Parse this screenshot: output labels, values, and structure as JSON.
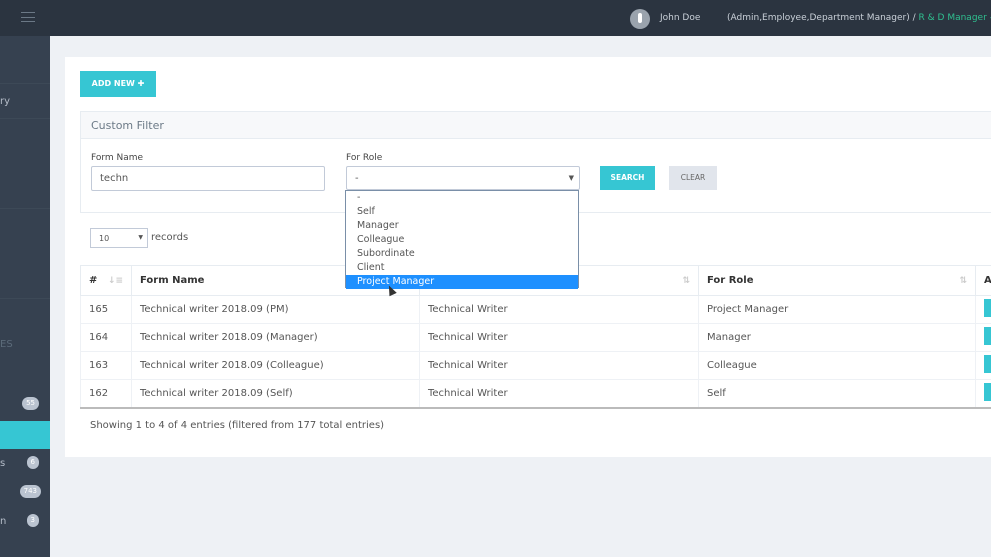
{
  "topbar": {
    "user": "John Doe",
    "roles": "(Admin,Employee,Department Manager) /",
    "position": " R & D Manager – C"
  },
  "sidebar": {
    "fragments": [
      "ry",
      "ES",
      "s",
      "n"
    ],
    "badges": [
      "55",
      "6",
      "743",
      "3"
    ]
  },
  "toolbar": {
    "add_new": "ADD NEW ✚"
  },
  "filter": {
    "title": "Custom Filter",
    "form_name_label": "Form Name",
    "form_name_value": "techn",
    "role_label": "For Role",
    "role_value": "-",
    "search": "SEARCH",
    "clear": "CLEAR",
    "role_options": [
      "-",
      "Self",
      "Manager",
      "Colleague",
      "Subordinate",
      "Client",
      "Project Manager"
    ],
    "highlighted": "Project Manager"
  },
  "records": {
    "value": "10",
    "label": "records"
  },
  "table": {
    "headers": [
      "#",
      "Form Name",
      "",
      "For Role",
      "A"
    ],
    "rows": [
      [
        "165",
        "Technical writer 2018.09 (PM)",
        "Technical Writer",
        "Project Manager"
      ],
      [
        "164",
        "Technical writer 2018.09 (Manager)",
        "Technical Writer",
        "Manager"
      ],
      [
        "163",
        "Technical writer 2018.09 (Colleague)",
        "Technical Writer",
        "Colleague"
      ],
      [
        "162",
        "Technical writer 2018.09 (Self)",
        "Technical Writer",
        "Self"
      ]
    ]
  },
  "footer": "Showing 1 to 4 of 4 entries (filtered from 177 total entries)",
  "colors": {
    "accent": "#36c6d3",
    "topbar": "#2b3440",
    "sidebar": "#364150",
    "highlight": "#1e90ff"
  }
}
